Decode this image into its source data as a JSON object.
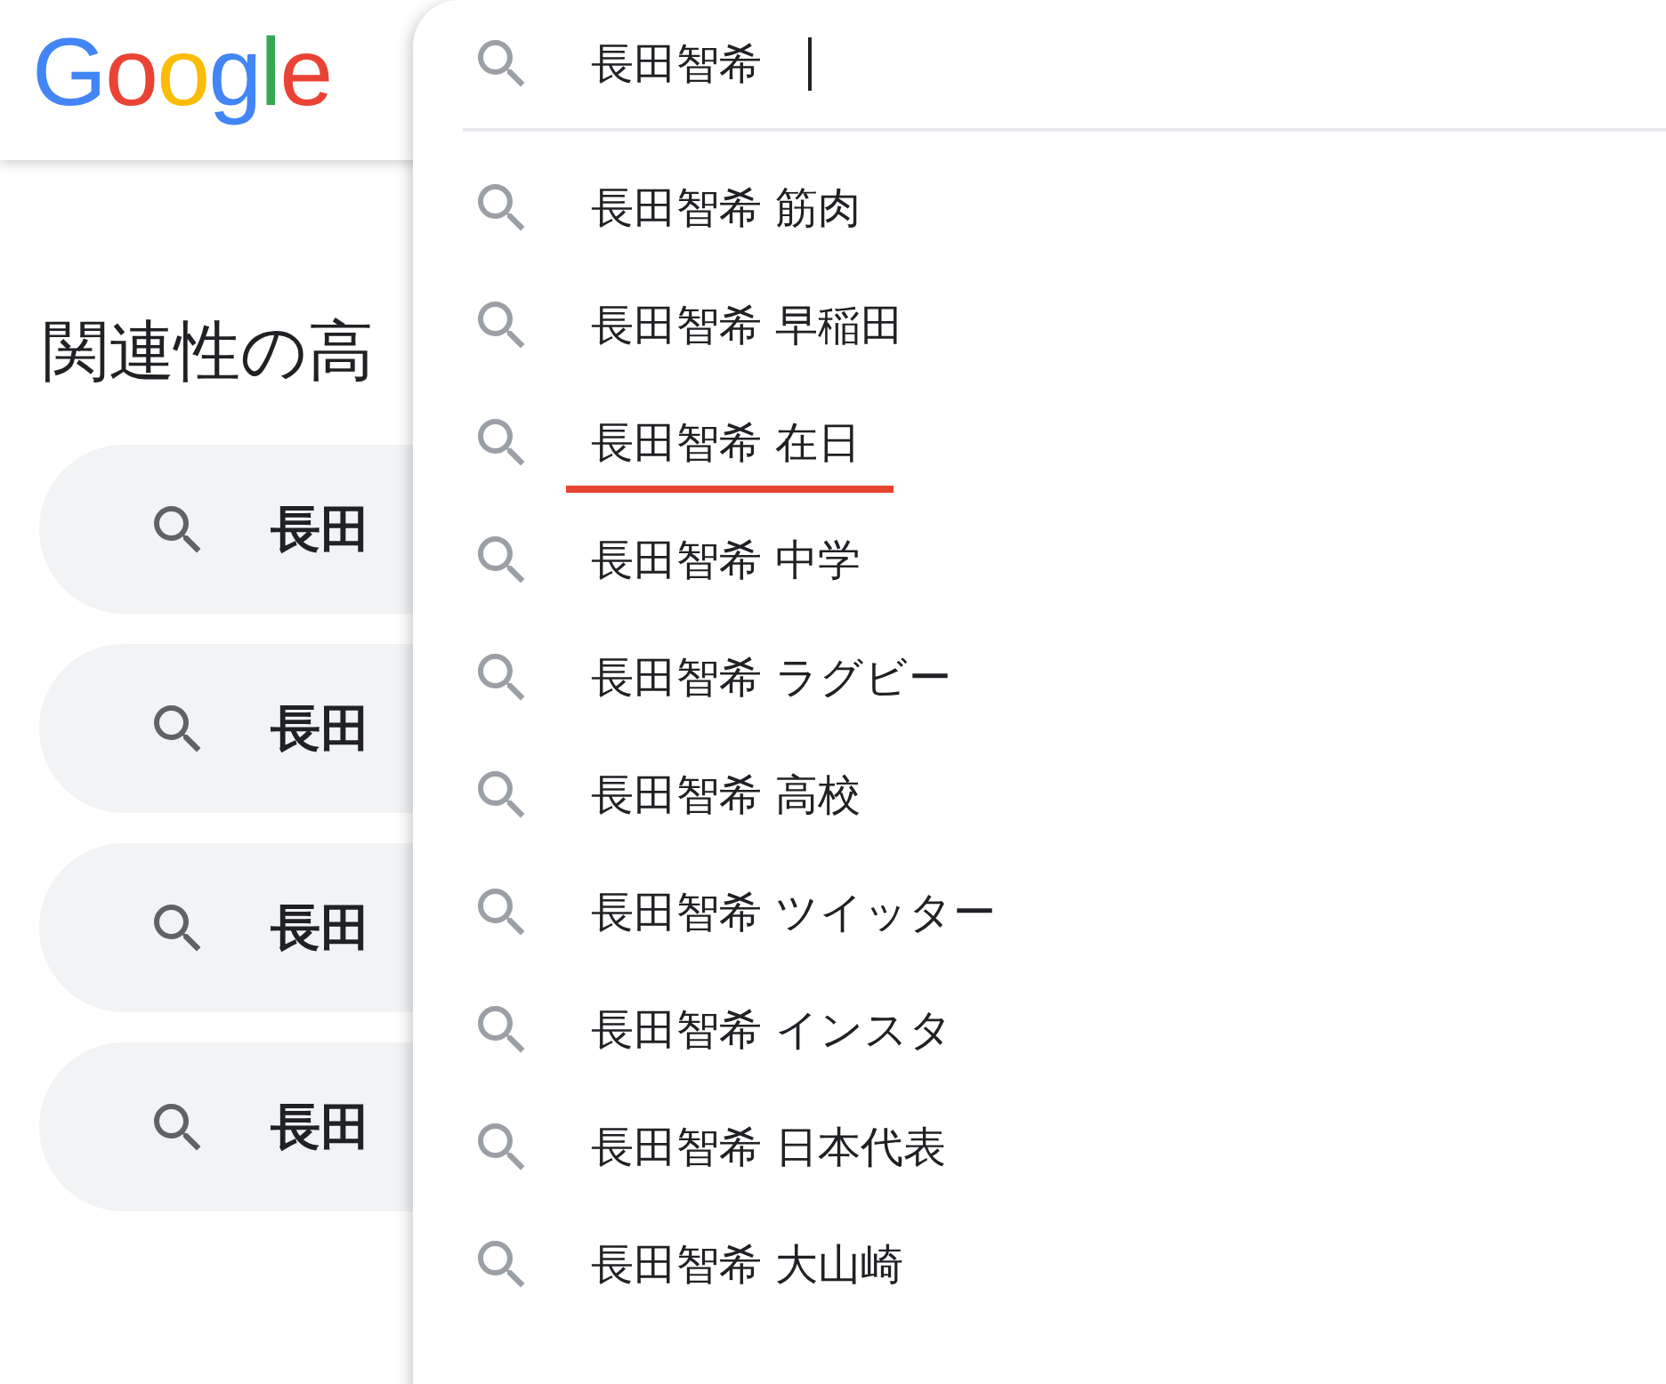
{
  "logo": "Google",
  "heading": "関連性の高",
  "related": [
    {
      "text": "長田"
    },
    {
      "text": "長田"
    },
    {
      "text": "長田"
    },
    {
      "text": "長田"
    }
  ],
  "search": {
    "value": "長田智希"
  },
  "suggestions": [
    {
      "text": "長田智希 筋肉",
      "underlined": false
    },
    {
      "text": "長田智希 早稲田",
      "underlined": false
    },
    {
      "text": "長田智希 在日",
      "underlined": true
    },
    {
      "text": "長田智希 中学",
      "underlined": false
    },
    {
      "text": "長田智希 ラグビー",
      "underlined": false
    },
    {
      "text": "長田智希 高校",
      "underlined": false
    },
    {
      "text": "長田智希 ツイッター",
      "underlined": false
    },
    {
      "text": "長田智希 インスタ",
      "underlined": false
    },
    {
      "text": "長田智希 日本代表",
      "underlined": false
    },
    {
      "text": "長田智希 大山崎",
      "underlined": false
    }
  ]
}
